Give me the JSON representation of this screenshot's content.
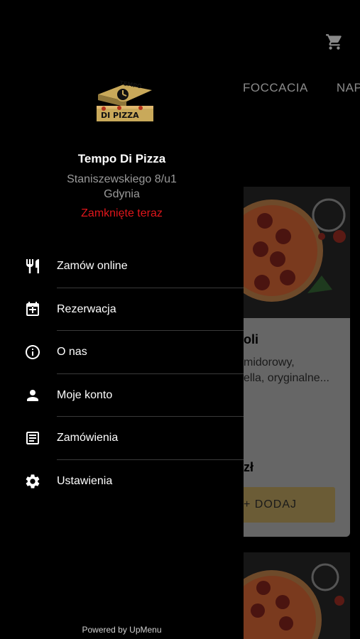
{
  "background": {
    "cart_icon": "cart-icon",
    "tabs": [
      "FOCCACIA",
      "NAPO"
    ],
    "product": {
      "title": "oli",
      "description_line1": "midorowy,",
      "description_line2": "ella, oryginalne...",
      "price": "zł",
      "add_label": "+ DODAJ"
    }
  },
  "drawer": {
    "restaurant_name": "Tempo Di Pizza",
    "address_line1": "Staniszewskiego 8/u1",
    "address_line2": "Gdynia",
    "status": "Zamknięte teraz",
    "status_color": "#e0161b",
    "menu": [
      {
        "label": "Zamów online",
        "icon": "restaurant-icon"
      },
      {
        "label": "Rezerwacja",
        "icon": "calendar-add-icon"
      },
      {
        "label": "O nas",
        "icon": "info-icon"
      },
      {
        "label": "Moje konto",
        "icon": "person-icon"
      },
      {
        "label": "Zamówienia",
        "icon": "receipt-icon"
      },
      {
        "label": "Ustawienia",
        "icon": "gear-icon"
      }
    ],
    "powered_by": "Powered by UpMenu",
    "logo_text_top": "TEMPO",
    "logo_text_bottom": "DI PIZZA"
  },
  "colors": {
    "accent_gold": "#c9a95a",
    "background": "#000000"
  }
}
